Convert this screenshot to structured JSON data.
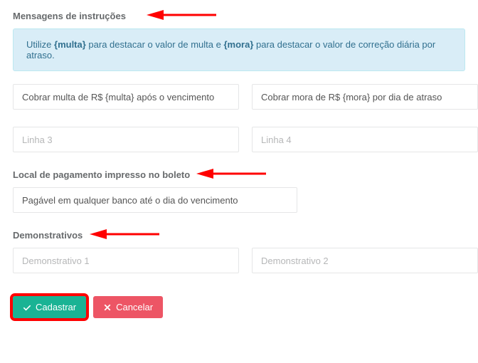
{
  "section1": {
    "label": "Mensagens de instruções",
    "info_prefix": "Utilize ",
    "info_token1": "{multa}",
    "info_middle": " para destacar o valor de multa e ",
    "info_token2": "{mora}",
    "info_suffix": " para destacar o valor de correção diária por atraso.",
    "line1_value": "Cobrar multa de R$ {multa} após o vencimento",
    "line2_value": "Cobrar mora de R$ {mora} por dia de atraso",
    "line3_placeholder": "Linha 3",
    "line4_placeholder": "Linha 4"
  },
  "section2": {
    "label": "Local de pagamento impresso no boleto",
    "value": "Pagável em qualquer banco até o dia do vencimento"
  },
  "section3": {
    "label": "Demonstrativos",
    "demo1_placeholder": "Demonstrativo 1",
    "demo2_placeholder": "Demonstrativo 2"
  },
  "buttons": {
    "submit": "Cadastrar",
    "cancel": "Cancelar"
  }
}
